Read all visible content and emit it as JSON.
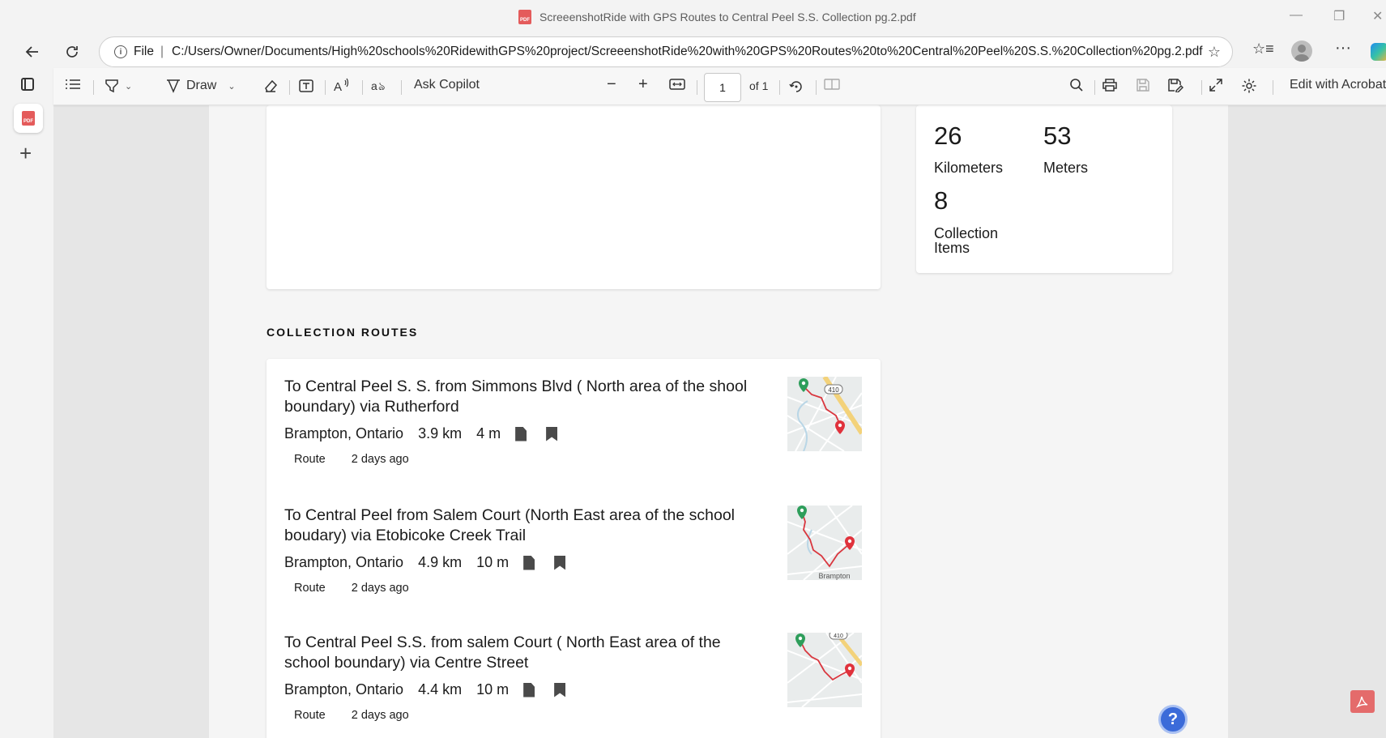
{
  "window": {
    "title": "ScreeenshotRide with GPS Routes to Central Peel S.S. Collection pg.2.pdf",
    "controls": {
      "minimize": "—",
      "restore": "❐",
      "close": "✕"
    }
  },
  "address_bar": {
    "security_label": "File",
    "url": "C:/Users/Owner/Documents/High%20schools%20RidewithGPS%20project/ScreeenshotRide%20with%20GPS%20Routes%20to%20Central%20Peel%20S.S.%20Collection%20pg.2.pdf"
  },
  "pdf_toolbar": {
    "draw_label": "Draw",
    "ask_copilot_label": "Ask Copilot",
    "page_current": "1",
    "page_total": "of 1",
    "edit_label": "Edit with Acrobat"
  },
  "stats": {
    "distance_value": "26",
    "distance_label": "Kilometers",
    "elevation_value": "53",
    "elevation_label": "Meters",
    "items_value": "8",
    "items_label_line1": "Collection",
    "items_label_line2": "Items"
  },
  "routes_section": {
    "title": "COLLECTION ROUTES",
    "routes": [
      {
        "title": "To Central Peel S. S. from Simmons Blvd ( North area of the shool boundary) via Rutherford",
        "location": "Brampton, Ontario",
        "distance": "3.9 km",
        "elevation": "4 m",
        "type": "Route",
        "age": "2 days ago",
        "map_label": "410"
      },
      {
        "title": "To Central Peel from Salem Court (North East area of the school boudary) via Etobicoke Creek Trail",
        "location": "Brampton, Ontario",
        "distance": "4.9 km",
        "elevation": "10 m",
        "type": "Route",
        "age": "2 days ago",
        "map_label": "Brampton"
      },
      {
        "title": "To Central Peel S.S. from salem Court ( North East area of the school boundary) via Centre Street",
        "location": "Brampton, Ontario",
        "distance": "4.4 km",
        "elevation": "10 m",
        "type": "Route",
        "age": "2 days ago",
        "map_label": "410"
      }
    ]
  },
  "colors": {
    "accent_blue": "#3b6bd9",
    "map_start_green": "#2e9e5b",
    "map_end_red": "#e0323c",
    "route_line_red": "#d9363e",
    "highway_yellow": "#f3d27a"
  }
}
